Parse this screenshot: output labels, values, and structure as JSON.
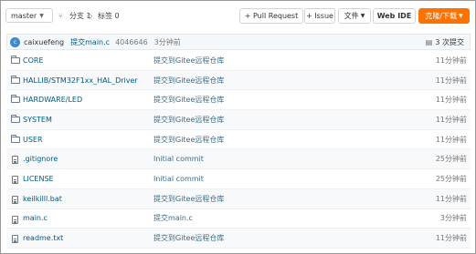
{
  "toolbar": {
    "branch": "master",
    "branches_label": "分支 1",
    "tags_label": "标签 0",
    "pull_request": "+ Pull Request",
    "issue": "+ Issue",
    "file_menu": "文件",
    "web_ide": "Web IDE",
    "clone_download": "克隆/下载"
  },
  "commit": {
    "author": "caixuefeng",
    "message": "提交main.c",
    "hash": "4046646",
    "time": "3分钟前",
    "count": "3 次提交"
  },
  "files": [
    {
      "type": "folder",
      "name": "CORE",
      "message": "提交到Gitee远程仓库",
      "time": "11分钟前"
    },
    {
      "type": "folder",
      "name": "HALLIB/STM32F1xx_HAL_Driver",
      "message": "提交到Gitee远程仓库",
      "time": "11分钟前"
    },
    {
      "type": "folder",
      "name": "HARDWARE/LED",
      "message": "提交到Gitee远程仓库",
      "time": "11分钟前"
    },
    {
      "type": "folder",
      "name": "SYSTEM",
      "message": "提交到Gitee远程仓库",
      "time": "11分钟前"
    },
    {
      "type": "folder",
      "name": "USER",
      "message": "提交到Gitee远程仓库",
      "time": "11分钟前"
    },
    {
      "type": "file",
      "name": ".gitignore",
      "message": "Initial commit",
      "time": "25分钟前"
    },
    {
      "type": "file",
      "name": "LICENSE",
      "message": "Initial commit",
      "time": "25分钟前"
    },
    {
      "type": "file",
      "name": "keilkilll.bat",
      "message": "提交到Gitee远程仓库",
      "time": "11分钟前"
    },
    {
      "type": "file",
      "name": "main.c",
      "message": "提交main.c",
      "time": "3分钟前"
    },
    {
      "type": "file",
      "name": "readme.txt",
      "message": "提交到Gitee远程仓库",
      "time": "11分钟前"
    }
  ]
}
